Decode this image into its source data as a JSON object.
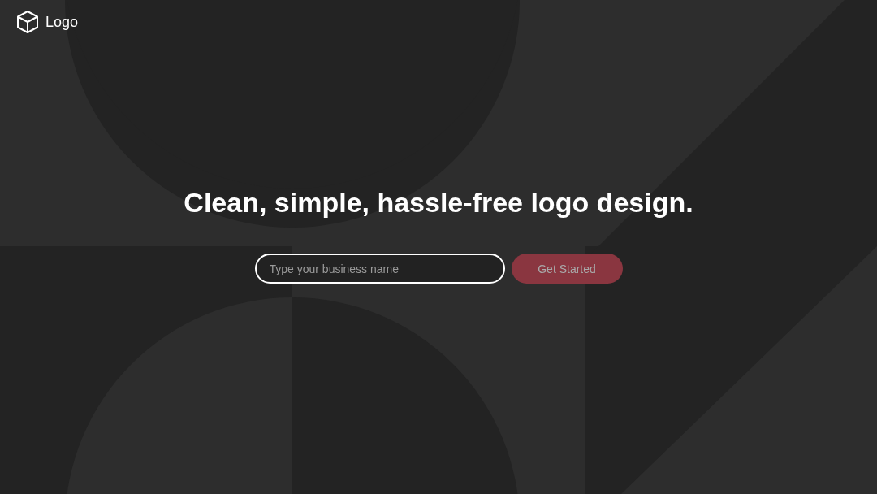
{
  "logo": {
    "label": "Logo"
  },
  "headline": "Clean, simple, hassle-free logo design.",
  "search": {
    "placeholder": "Type your business name"
  },
  "button": {
    "label": "Get Started",
    "disabled": true
  }
}
